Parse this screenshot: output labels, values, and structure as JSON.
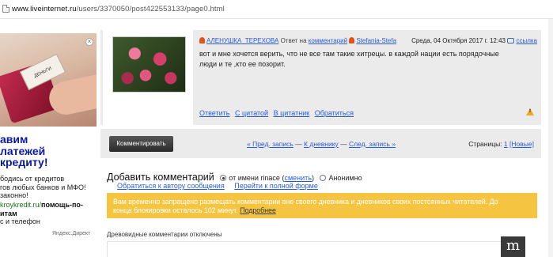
{
  "url_bar": {
    "host": "www.liveinternet.ru",
    "path": "/users/3370050/post422553133/page0.html"
  },
  "ad": {
    "card_text": "ДЕНЬГИ",
    "close": "×",
    "title": "авим\nлатежей\nкредиту!",
    "body": "бодись от кредитов\nгов любых банков и МФО!\n законно!",
    "link_domain": "kroykredit.ru/",
    "link_bold": "помощь-по-",
    "link_line2": "итам",
    "footer": "с и телефон",
    "yandex": "Яндекс.Директ"
  },
  "comment": {
    "author": "АЛЕНУШКА_ТЕРЕХОВА",
    "reply_prefix": "Ответ на",
    "reply_link": "комментарий",
    "reply_to": "Stefania-Stefa",
    "date": "Среда, 04 Октября 2017 г. 12:43",
    "link_label": "ссылка",
    "text_line1": "вот и мне хочется верить, что не все там такие хитрецы. в каждой нации есть порядочные",
    "text_line2": "люди и те ,кто ее позорит.",
    "actions": [
      "Ответить",
      "С цитатой",
      "В цитатник",
      "Обратиться"
    ]
  },
  "pager": {
    "button": "Комментировать",
    "prev": "« Пред. запись",
    "diary": "К дневнику",
    "next": "След. запись »",
    "pages_label": "Страницы:",
    "page_current": "1",
    "page_new": "[Новые]"
  },
  "add_comment": {
    "title": "Добавить комментарий",
    "as_user": "от имени rinace",
    "change": "сменить",
    "anonymous": "Анонимно",
    "link_author": "Обратиться к автору сообщения",
    "link_full": "Перейти к полной форме"
  },
  "notice": {
    "line1": "Вам временно запрещено размещать комментарии вне своего дневника и дневников своих постоянных читателей. До",
    "line2": "конца блокировки осталось 102 минут.",
    "more": "Подробнее"
  },
  "tree_note": "Древовидные комментарии отключены",
  "badge": "m"
}
